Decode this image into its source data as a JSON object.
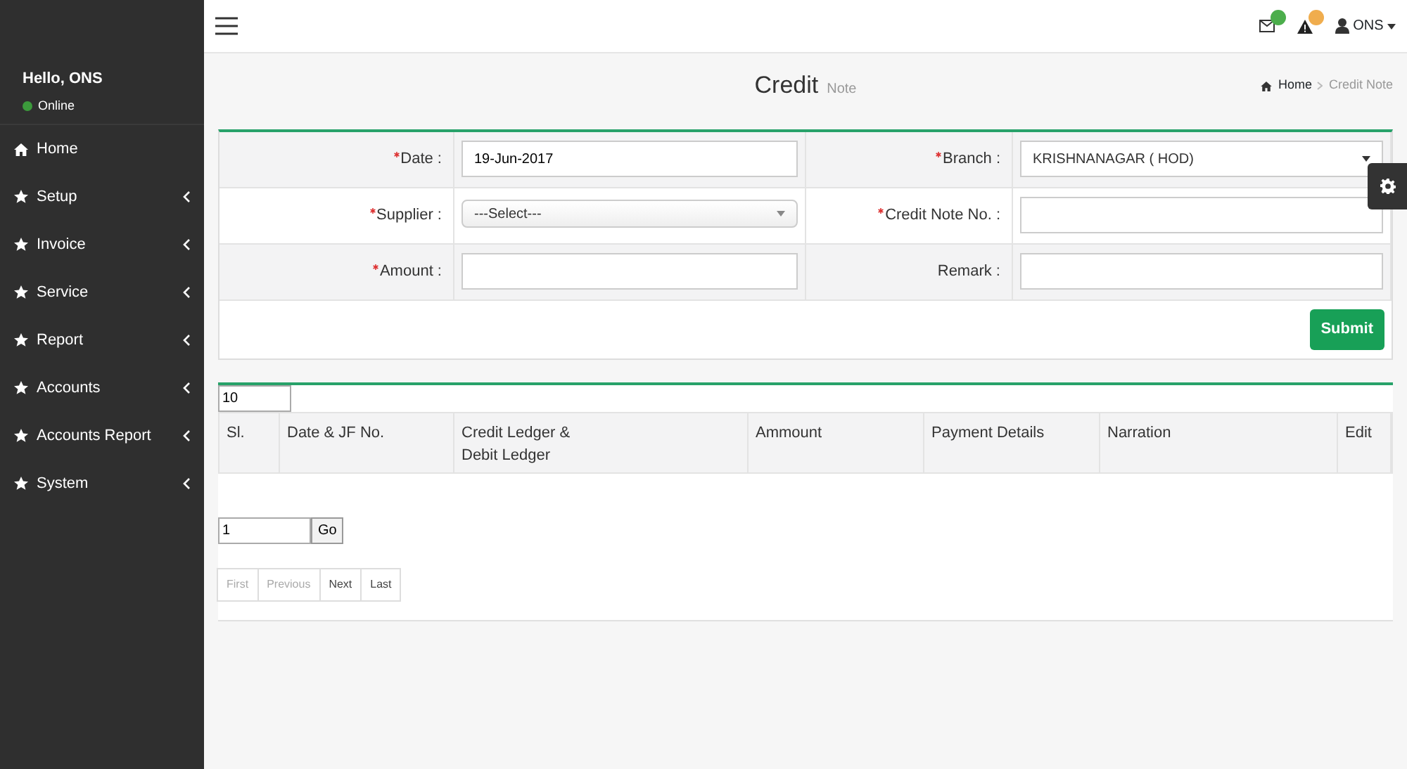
{
  "user_panel": {
    "greeting": "Hello, ONS",
    "status": "Online"
  },
  "menu": [
    {
      "label": "Home",
      "kind": "link"
    },
    {
      "label": "Setup",
      "kind": "submenu"
    },
    {
      "label": "Invoice",
      "kind": "submenu"
    },
    {
      "label": "Service",
      "kind": "submenu"
    },
    {
      "label": "Report",
      "kind": "submenu"
    },
    {
      "label": "Accounts",
      "kind": "submenu"
    },
    {
      "label": "Accounts Report",
      "kind": "submenu"
    },
    {
      "label": "System",
      "kind": "submenu"
    }
  ],
  "header": {
    "notifications": [
      {
        "kind": "mail",
        "color": "#4cae4c"
      },
      {
        "kind": "alert",
        "color": "#f0ad4e"
      }
    ],
    "user": "ONS"
  },
  "page": {
    "title": "Credit",
    "subtitle": "Note",
    "breadcrumb": [
      {
        "label": "Home",
        "kind": "link"
      },
      {
        "label": "Credit Note",
        "kind": "current"
      }
    ]
  },
  "form": {
    "rows": [
      [
        {
          "label": "Date :",
          "required": true,
          "kind": "input",
          "value": "19-Jun-2017"
        },
        {
          "label": "Branch :",
          "required": true,
          "kind": "native-select",
          "value": "KRISHNANAGAR ( HOD)"
        }
      ],
      [
        {
          "label": "Supplier :",
          "required": true,
          "kind": "select",
          "value": "---Select---"
        },
        {
          "label": "Credit Note No. :",
          "required": true,
          "kind": "input"
        }
      ],
      [
        {
          "label": "Amount :",
          "required": true,
          "kind": "input"
        },
        {
          "label": "Remark :",
          "required": false,
          "kind": "input"
        }
      ]
    ],
    "submit": "Submit"
  },
  "table": {
    "page_size": "10",
    "columns": [
      "Sl.",
      "Date & JF No.",
      "Credit Ledger &\nDebit Ledger",
      "Ammount",
      "Payment Details",
      "Narration",
      "Edit"
    ],
    "goto_value": "1",
    "goto_button": "Go",
    "pager": [
      {
        "label": "First",
        "disabled": true
      },
      {
        "label": "Previous",
        "disabled": true
      },
      {
        "label": "Next",
        "disabled": false
      },
      {
        "label": "Last",
        "disabled": false
      }
    ]
  }
}
